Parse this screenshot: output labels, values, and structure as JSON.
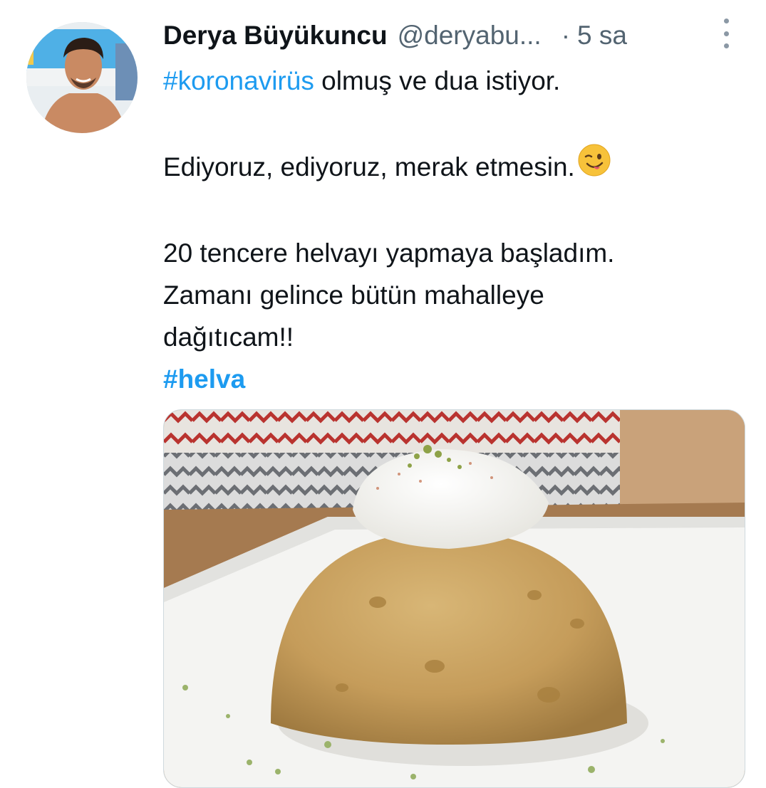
{
  "tweet": {
    "author_name": "Derya Büyükuncu",
    "handle": "@deryabu...",
    "separator": "·",
    "time": "5 sa",
    "text": {
      "line1_hashtag": "#koronavirüs",
      "line1_rest": " olmuş ve dua istiyor.",
      "line2": "Ediyoruz, ediyoruz, merak etmesin.",
      "line3": "20 tencere helvayı yapmaya başladım.",
      "line4": "Zamanı gelince bütün mahalleye",
      "line5": "dağıtıcam!!",
      "hashtag2": "#helva"
    },
    "emoji": "winking-face-with-tongue",
    "media_icon": "helva-dessert-photo"
  },
  "colors": {
    "link": "#1d9bf0",
    "text": "#0f1419",
    "secondary": "#536471"
  }
}
